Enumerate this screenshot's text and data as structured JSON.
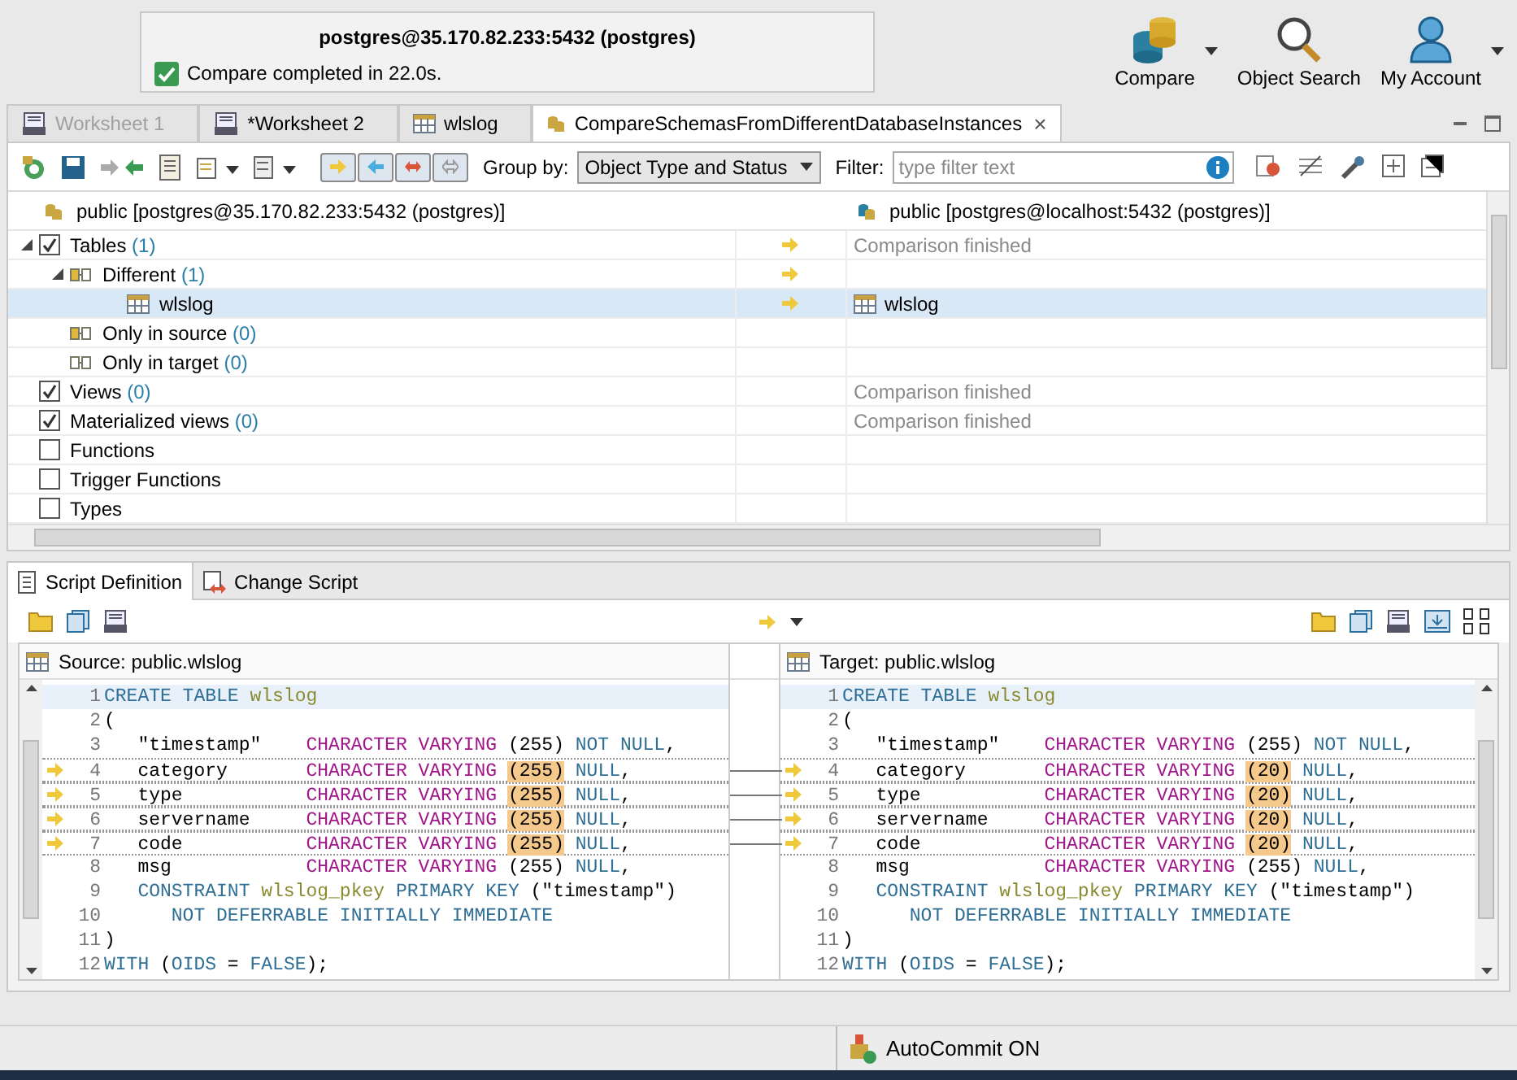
{
  "notification": {
    "title": "postgres@35.170.82.233:5432 (postgres)",
    "message": "Compare completed in 22.0s."
  },
  "top_buttons": [
    {
      "kind": "compare",
      "label": "Compare",
      "dropdown": true
    },
    {
      "kind": "search",
      "label": "Object Search",
      "dropdown": false
    },
    {
      "kind": "account",
      "label": "My Account",
      "dropdown": true
    }
  ],
  "editor_tabs": [
    {
      "kind": "sql",
      "label": "Worksheet 1",
      "selected": false,
      "disabled": true
    },
    {
      "kind": "sql",
      "label": "*Worksheet 2",
      "selected": false,
      "disabled": false
    },
    {
      "kind": "table",
      "label": "wlslog",
      "selected": false,
      "disabled": false
    },
    {
      "kind": "compare",
      "label": "CompareSchemasFromDifferentDatabaseInstances",
      "selected": true,
      "disabled": false,
      "close": "×"
    }
  ],
  "compare_toolbar": {
    "direction_filters": [
      {
        "kind": "source",
        "on": true
      },
      {
        "kind": "target",
        "on": true
      },
      {
        "kind": "both",
        "on": true
      },
      {
        "kind": "equal",
        "on": true
      }
    ],
    "group_by": {
      "label": "Group by:",
      "value": "Object Type and Status"
    },
    "filter": {
      "label": "Filter:",
      "placeholder": "type filter text"
    }
  },
  "tree": {
    "source_header": "public [postgres@35.170.82.233:5432 (postgres)]",
    "target_header": "public [postgres@localhost:5432 (postgres)]",
    "rows": [
      {
        "kind": "category",
        "label": "Tables",
        "count": "(1)",
        "checked": true,
        "expanded": true,
        "selected": false,
        "arrow": true,
        "status": "Comparison finished",
        "children": [
          {
            "kind": "group",
            "label": "Different",
            "count": "(1)",
            "expanded": true,
            "selected": false,
            "arrow": true,
            "children": [
              {
                "kind": "table",
                "label": "wlslog",
                "selected": true,
                "arrow": true,
                "target": "wlslog"
              }
            ]
          },
          {
            "kind": "group",
            "label": "Only in source",
            "count": "(0)",
            "selected": false,
            "arrow": false
          },
          {
            "kind": "group_target",
            "label": "Only in target",
            "count": "(0)",
            "selected": false,
            "arrow": false
          }
        ]
      },
      {
        "kind": "category",
        "label": "Views",
        "count": "(0)",
        "checked": true,
        "selected": false,
        "arrow": false,
        "status": "Comparison finished"
      },
      {
        "kind": "category",
        "label": "Materialized views",
        "count": "(0)",
        "checked": true,
        "selected": false,
        "arrow": false,
        "status": "Comparison finished"
      },
      {
        "kind": "category",
        "label": "Functions",
        "checked": false,
        "selected": false,
        "arrow": false
      },
      {
        "kind": "category",
        "label": "Trigger Functions",
        "checked": false,
        "selected": false,
        "arrow": false
      },
      {
        "kind": "category",
        "label": "Types",
        "checked": false,
        "selected": false,
        "arrow": false
      }
    ]
  },
  "script_tabs": [
    {
      "kind": "definition",
      "label": "Script Definition",
      "selected": true
    },
    {
      "kind": "change",
      "label": "Change Script",
      "selected": false
    }
  ],
  "panes": [
    {
      "title": "Source: public.wlslog",
      "lines": [
        {
          "num": "1",
          "current": true,
          "changed": false,
          "tokens": [
            {
              "kind": "kw",
              "text": "CREATE TABLE "
            },
            {
              "kind": "name",
              "text": "wlslog"
            }
          ]
        },
        {
          "num": "2",
          "current": false,
          "changed": false,
          "tokens": [
            {
              "kind": "plain",
              "text": "("
            }
          ]
        },
        {
          "num": "3",
          "current": false,
          "changed": false,
          "tokens": [
            {
              "kind": "plain",
              "text": "   \"timestamp\"    "
            },
            {
              "kind": "type",
              "text": "CHARACTER VARYING"
            },
            {
              "kind": "plain",
              "text": " (255) "
            },
            {
              "kind": "kw",
              "text": "NOT NULL"
            },
            {
              "kind": "plain",
              "text": ","
            }
          ]
        },
        {
          "num": "4",
          "current": false,
          "changed": true,
          "tokens": [
            {
              "kind": "plain",
              "text": "   category       "
            },
            {
              "kind": "type",
              "text": "CHARACTER VARYING "
            },
            {
              "kind": "diff",
              "text": "(255)"
            },
            {
              "kind": "kw",
              "text": " NULL"
            },
            {
              "kind": "plain",
              "text": ","
            }
          ]
        },
        {
          "num": "5",
          "current": false,
          "changed": true,
          "tokens": [
            {
              "kind": "plain",
              "text": "   type           "
            },
            {
              "kind": "type",
              "text": "CHARACTER VARYING "
            },
            {
              "kind": "diff",
              "text": "(255)"
            },
            {
              "kind": "kw",
              "text": " NULL"
            },
            {
              "kind": "plain",
              "text": ","
            }
          ]
        },
        {
          "num": "6",
          "current": false,
          "changed": true,
          "tokens": [
            {
              "kind": "plain",
              "text": "   servername     "
            },
            {
              "kind": "type",
              "text": "CHARACTER VARYING "
            },
            {
              "kind": "diff",
              "text": "(255)"
            },
            {
              "kind": "kw",
              "text": " NULL"
            },
            {
              "kind": "plain",
              "text": ","
            }
          ]
        },
        {
          "num": "7",
          "current": false,
          "changed": true,
          "tokens": [
            {
              "kind": "plain",
              "text": "   code           "
            },
            {
              "kind": "type",
              "text": "CHARACTER VARYING "
            },
            {
              "kind": "diff",
              "text": "(255)"
            },
            {
              "kind": "kw",
              "text": " NULL"
            },
            {
              "kind": "plain",
              "text": ","
            }
          ]
        },
        {
          "num": "8",
          "current": false,
          "changed": false,
          "tokens": [
            {
              "kind": "plain",
              "text": "   msg            "
            },
            {
              "kind": "type",
              "text": "CHARACTER VARYING"
            },
            {
              "kind": "plain",
              "text": " (255) "
            },
            {
              "kind": "kw",
              "text": "NULL"
            },
            {
              "kind": "plain",
              "text": ","
            }
          ]
        },
        {
          "num": "9",
          "current": false,
          "changed": false,
          "tokens": [
            {
              "kind": "kw",
              "text": "   CONSTRAINT "
            },
            {
              "kind": "name",
              "text": "wlslog_pkey"
            },
            {
              "kind": "kw",
              "text": " PRIMARY KEY "
            },
            {
              "kind": "plain",
              "text": "(\"timestamp\")"
            }
          ]
        },
        {
          "num": "10",
          "current": false,
          "changed": false,
          "tokens": [
            {
              "kind": "kw",
              "text": "      NOT DEFERRABLE INITIALLY IMMEDIATE"
            }
          ]
        },
        {
          "num": "11",
          "current": false,
          "changed": false,
          "tokens": [
            {
              "kind": "plain",
              "text": ")"
            }
          ]
        },
        {
          "num": "12",
          "current": false,
          "changed": false,
          "tokens": [
            {
              "kind": "kw",
              "text": "WITH "
            },
            {
              "kind": "plain",
              "text": "("
            },
            {
              "kind": "kw",
              "text": "OIDS"
            },
            {
              "kind": "plain",
              "text": " = "
            },
            {
              "kind": "kw",
              "text": "FALSE"
            },
            {
              "kind": "plain",
              "text": ");"
            }
          ]
        }
      ]
    },
    {
      "title": "Target: public.wlslog",
      "lines": [
        {
          "num": "1",
          "current": true,
          "changed": false,
          "tokens": [
            {
              "kind": "kw",
              "text": "CREATE TABLE "
            },
            {
              "kind": "name",
              "text": "wlslog"
            }
          ]
        },
        {
          "num": "2",
          "current": false,
          "changed": false,
          "tokens": [
            {
              "kind": "plain",
              "text": "("
            }
          ]
        },
        {
          "num": "3",
          "current": false,
          "changed": false,
          "tokens": [
            {
              "kind": "plain",
              "text": "   \"timestamp\"    "
            },
            {
              "kind": "type",
              "text": "CHARACTER VARYING"
            },
            {
              "kind": "plain",
              "text": " (255) "
            },
            {
              "kind": "kw",
              "text": "NOT NULL"
            },
            {
              "kind": "plain",
              "text": ","
            }
          ]
        },
        {
          "num": "4",
          "current": false,
          "changed": true,
          "tokens": [
            {
              "kind": "plain",
              "text": "   category       "
            },
            {
              "kind": "type",
              "text": "CHARACTER VARYING "
            },
            {
              "kind": "diff",
              "text": "(20)"
            },
            {
              "kind": "kw",
              "text": " NULL"
            },
            {
              "kind": "plain",
              "text": ","
            }
          ]
        },
        {
          "num": "5",
          "current": false,
          "changed": true,
          "tokens": [
            {
              "kind": "plain",
              "text": "   type           "
            },
            {
              "kind": "type",
              "text": "CHARACTER VARYING "
            },
            {
              "kind": "diff",
              "text": "(20)"
            },
            {
              "kind": "kw",
              "text": " NULL"
            },
            {
              "kind": "plain",
              "text": ","
            }
          ]
        },
        {
          "num": "6",
          "current": false,
          "changed": true,
          "tokens": [
            {
              "kind": "plain",
              "text": "   servername     "
            },
            {
              "kind": "type",
              "text": "CHARACTER VARYING "
            },
            {
              "kind": "diff",
              "text": "(20)"
            },
            {
              "kind": "kw",
              "text": " NULL"
            },
            {
              "kind": "plain",
              "text": ","
            }
          ]
        },
        {
          "num": "7",
          "current": false,
          "changed": true,
          "tokens": [
            {
              "kind": "plain",
              "text": "   code           "
            },
            {
              "kind": "type",
              "text": "CHARACTER VARYING "
            },
            {
              "kind": "diff",
              "text": "(20)"
            },
            {
              "kind": "kw",
              "text": " NULL"
            },
            {
              "kind": "plain",
              "text": ","
            }
          ]
        },
        {
          "num": "8",
          "current": false,
          "changed": false,
          "tokens": [
            {
              "kind": "plain",
              "text": "   msg            "
            },
            {
              "kind": "type",
              "text": "CHARACTER VARYING"
            },
            {
              "kind": "plain",
              "text": " (255) "
            },
            {
              "kind": "kw",
              "text": "NULL"
            },
            {
              "kind": "plain",
              "text": ","
            }
          ]
        },
        {
          "num": "9",
          "current": false,
          "changed": false,
          "tokens": [
            {
              "kind": "kw",
              "text": "   CONSTRAINT "
            },
            {
              "kind": "name",
              "text": "wlslog_pkey"
            },
            {
              "kind": "kw",
              "text": " PRIMARY KEY "
            },
            {
              "kind": "plain",
              "text": "(\"timestamp\")"
            }
          ]
        },
        {
          "num": "10",
          "current": false,
          "changed": false,
          "tokens": [
            {
              "kind": "kw",
              "text": "      NOT DEFERRABLE INITIALLY IMMEDIATE"
            }
          ]
        },
        {
          "num": "11",
          "current": false,
          "changed": false,
          "tokens": [
            {
              "kind": "plain",
              "text": ")"
            }
          ]
        },
        {
          "num": "12",
          "current": false,
          "changed": false,
          "tokens": [
            {
              "kind": "kw",
              "text": "WITH "
            },
            {
              "kind": "plain",
              "text": "("
            },
            {
              "kind": "kw",
              "text": "OIDS"
            },
            {
              "kind": "plain",
              "text": " = "
            },
            {
              "kind": "kw",
              "text": "FALSE"
            },
            {
              "kind": "plain",
              "text": ");"
            }
          ]
        }
      ]
    }
  ],
  "status_bar": {
    "autocommit": "AutoCommit ON"
  }
}
